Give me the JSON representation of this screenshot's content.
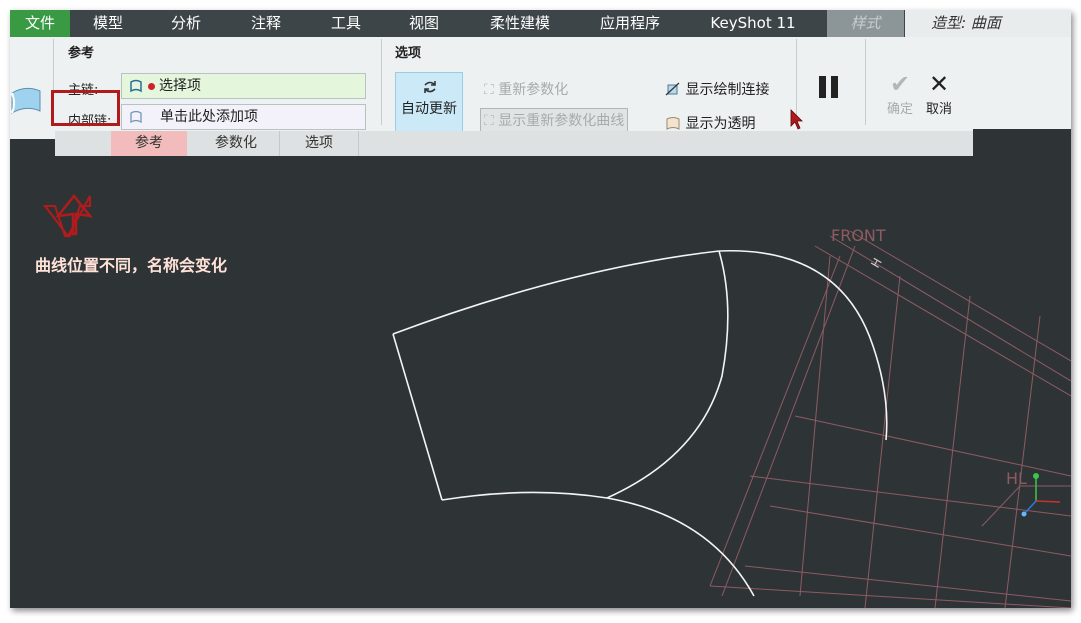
{
  "menu": {
    "file": "文件",
    "items": [
      "模型",
      "分析",
      "注释",
      "工具",
      "视图",
      "柔性建模",
      "应用程序",
      "KeyShot 11"
    ],
    "style_tab": "样式",
    "active_tab": "造型: 曲面"
  },
  "ribbon": {
    "reference_group_title": "参考",
    "main_chain_label": "主链:",
    "main_chain_value": "选择项",
    "inner_chain_label": "内部链:",
    "inner_chain_value": "单击此处添加项",
    "options_group_title": "选项",
    "auto_update_label": "自动更新",
    "reparameterize_label": "重新参数化",
    "show_reparam_curves_label": "显示重新参数化曲线",
    "show_control_connection_label": "显示绘制连接",
    "show_transparent_label": "显示为透明",
    "pause_icon": "pause-icon",
    "ok_label": "确定",
    "cancel_label": "取消"
  },
  "tabs": [
    "参考",
    "参数化",
    "选项"
  ],
  "viewport": {
    "front_label": "FRONT",
    "h_label": "H",
    "hl_label": "HL",
    "annotation": "曲线位置不同，名称会变化"
  },
  "colors": {
    "menu_bg": "#3d4549",
    "file_tab": "#3a9a43",
    "viewport_bg": "#2e3436",
    "annotation_red": "#b21b1b",
    "datum_plane": "#8e5b62"
  }
}
